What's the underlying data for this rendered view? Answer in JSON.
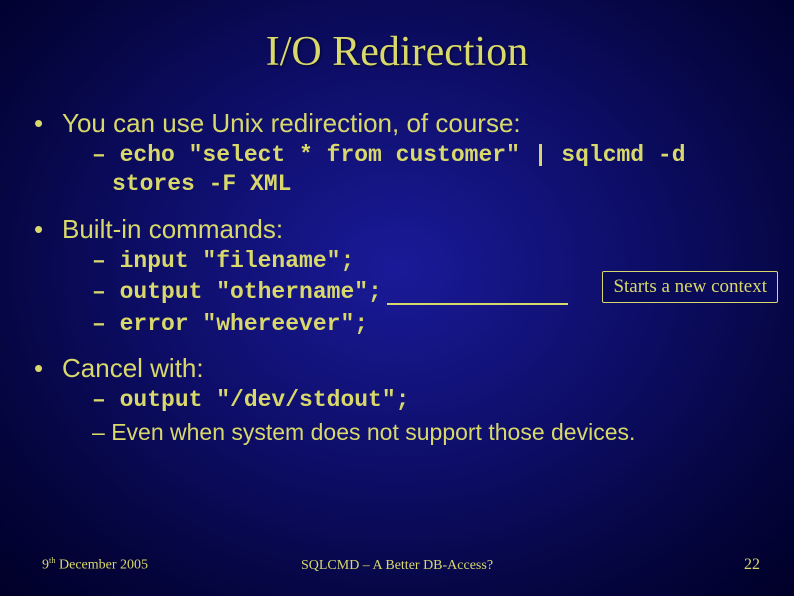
{
  "slide": {
    "title": "I/O Redirection",
    "bullets": {
      "b1": "You can use Unix redirection, of course:",
      "b1a": "echo \"select * from customer\" | sqlcmd -d stores -F XML",
      "b2": "Built-in commands:",
      "b2a": "input \"filename\";",
      "b2b": "output \"othername\";",
      "b2c": "error \"whereever\";",
      "b3": "Cancel with:",
      "b3a": "output \"/dev/stdout\";",
      "b3b": "Even when system does not support those devices."
    },
    "callout": "Starts a new context"
  },
  "footer": {
    "date_pre": "9",
    "date_sup": "th",
    "date_post": " December 2005",
    "middle": "SQLCMD – A Better DB-Access?",
    "page": "22"
  }
}
